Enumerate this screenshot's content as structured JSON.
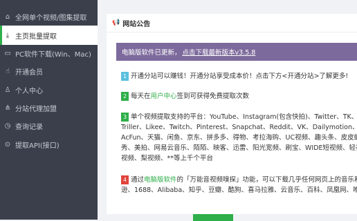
{
  "sidebar": {
    "items": [
      {
        "icon": "home-icon",
        "glyph": "⌂",
        "label": "全网单个视频/图集提取"
      },
      {
        "icon": "download-icon",
        "glyph": "⤓",
        "label": "主页批量提取"
      },
      {
        "icon": "monitor-icon",
        "glyph": "▭",
        "label": "PC软件下载(Win、Mac)"
      },
      {
        "icon": "thumbs-up-icon",
        "glyph": "👍",
        "label": "开通会员"
      },
      {
        "icon": "user-icon",
        "glyph": "👤",
        "label": "个人中心"
      },
      {
        "icon": "share-icon",
        "glyph": "⋔",
        "label": "分站代理加盟"
      },
      {
        "icon": "clock-icon",
        "glyph": "◷",
        "label": "查询记录"
      },
      {
        "icon": "api-icon",
        "glyph": "⊙",
        "label": "提取API(接口)"
      }
    ]
  },
  "panel": {
    "title": "网站公告",
    "notice_text": "电脑版软件已更新，",
    "notice_link": "点击下载最新版本v3.5.8",
    "item1_num": "1",
    "item1_text": "开通分站可以赚钱！开通分站享受成本价！点击下方<开通分站>了解更多!",
    "item2_num": "2",
    "item2_pre": "每天在",
    "item2_link": "用户中心",
    "item2_post": "签到可获得免费提取次数",
    "item3_num": "3",
    "item3_line1": "单个视频提取支持的平台：YouTube、Instagram(包含快拍)、Twitter、TK、Thread",
    "item3_line2": "Triller、Likee、Twitch、Pinterest、Snapchat、Reddit、VK、Dailymotion、SoundClou",
    "item3_line3": "AcFun、天猫、闲鱼、京东、拼多多、得物、考拉海购、UC视频、趣头条、皮皮虾、",
    "item3_line4": "秀、美拍、网易云音乐、陌陌、映客、迅雷、阳光宽频、刷宝、WIDE短视频、轻视频",
    "item3_line5": "视频、梨视频、**等上千个平台",
    "item4_num": "4",
    "item4_pre": "通过",
    "item4_link": "电脑版软件",
    "item4_post": "的「万能音视频嗅探」功能，可以下载几乎任何网页上的音乐和视频",
    "item4_line2": "逊、1688、Alibaba、知乎、豆瓣、酷狗、喜马拉雅、云音乐、百科、凤凰网、唯品会等"
  },
  "colors": {
    "sidebar": "#3a3f4b",
    "accent": "#2eaf4a",
    "notice": "#7d6a9c",
    "badge1": "#5bc0de",
    "badge2": "#2eaf4a",
    "badge3": "#2eaf4a",
    "badge4": "#e0443c"
  }
}
